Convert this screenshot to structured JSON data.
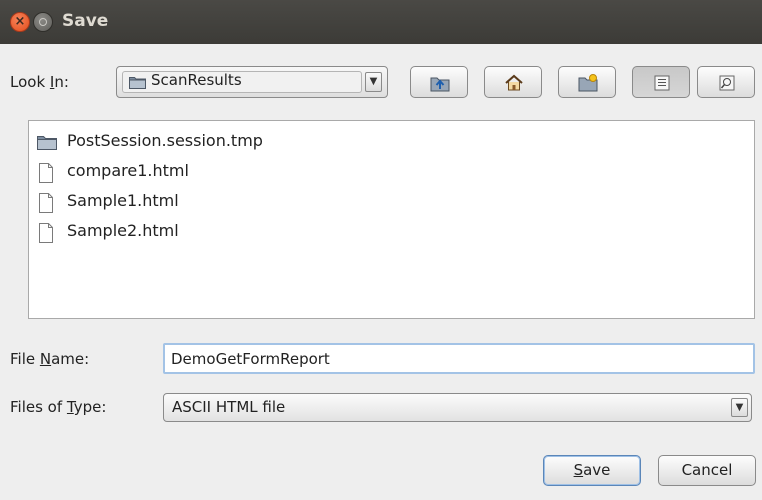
{
  "window": {
    "title": "Save"
  },
  "lookin": {
    "label_pre": "Look ",
    "label_mn": "I",
    "label_post": "n:",
    "value": "ScanResults"
  },
  "toolbar": {
    "icons": [
      "up-folder-icon",
      "home-icon",
      "new-folder-icon",
      "list-view-icon",
      "details-view-icon"
    ]
  },
  "files": [
    {
      "name": "PostSession.session.tmp",
      "type": "folder"
    },
    {
      "name": "compare1.html",
      "type": "file"
    },
    {
      "name": "Sample1.html",
      "type": "file"
    },
    {
      "name": "Sample2.html",
      "type": "file"
    }
  ],
  "filename": {
    "label_pre": "File ",
    "label_mn": "N",
    "label_post": "ame:",
    "value": "DemoGetFormReport"
  },
  "filetype": {
    "label_pre": "Files of ",
    "label_mn": "T",
    "label_post": "ype:",
    "value": "ASCII HTML file"
  },
  "buttons": {
    "save_mn": "S",
    "save_rest": "ave",
    "cancel": "Cancel"
  },
  "colors": {
    "title_bar": "#3c3b37",
    "close": "#e24d1b",
    "focus": "#a3c3e6"
  }
}
